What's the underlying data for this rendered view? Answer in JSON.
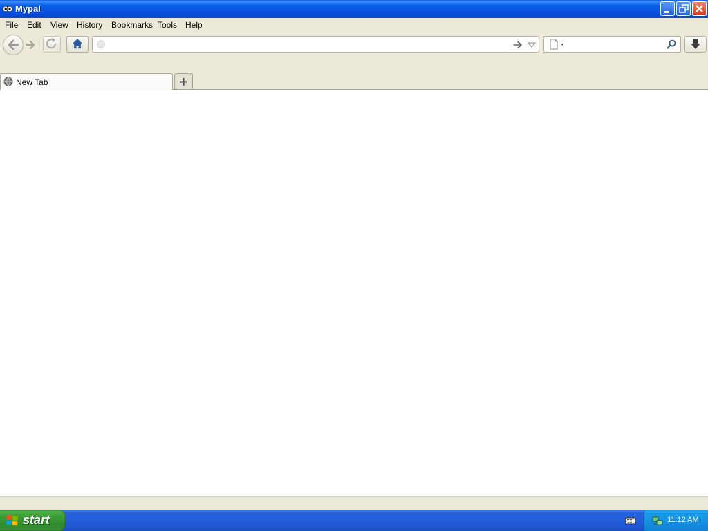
{
  "window": {
    "title": "Mypal"
  },
  "menu": [
    "File",
    "Edit",
    "View",
    "History",
    "Bookmarks",
    "Tools",
    "Help"
  ],
  "address_bar": {
    "value": "",
    "placeholder": ""
  },
  "search_bar": {
    "value": "",
    "placeholder": ""
  },
  "tabs": [
    {
      "label": "New Tab"
    }
  ],
  "taskbar": {
    "start_label": "start",
    "clock": "11:12 AM"
  },
  "icons": {
    "app": "mypal-icon",
    "back": "back-arrow-icon",
    "forward": "forward-arrow-icon",
    "reload": "reload-icon",
    "home": "home-icon",
    "go": "go-arrow-icon",
    "search": "magnifier-icon",
    "download": "download-arrow-icon",
    "new_tab": "plus-icon",
    "start": "windows-logo-icon",
    "keyboard": "keyboard-icon",
    "network": "network-icon"
  },
  "colors": {
    "titlebar": "#0b5fe8",
    "chrome": "#ece9d8",
    "taskbar": "#245ddb",
    "start": "#3c9d38",
    "tray": "#1aa0ee"
  }
}
